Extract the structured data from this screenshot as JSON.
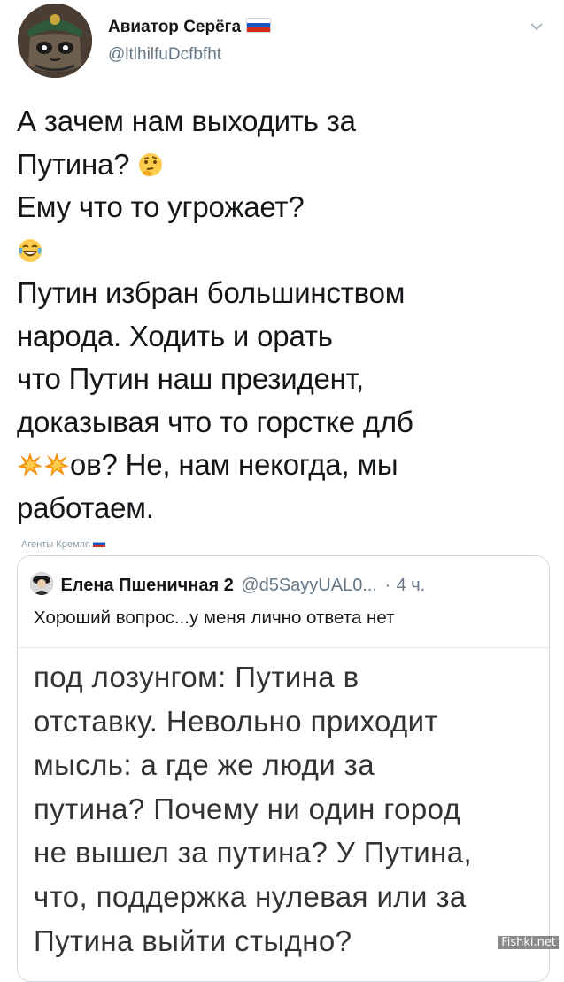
{
  "tweet": {
    "author_name": "Авиатор Серёга",
    "handle": "@ltlhilfuDcfbfht",
    "lines": [
      "А зачем нам выходить за",
      "Путина?",
      "Ему что то угрожает?",
      "",
      "Путин избран большинством",
      "народа. Ходить и орать",
      "что Путин наш президент,",
      "доказывая что то горстке длб",
      "ов? Не, нам некогда, мы",
      "работаем."
    ],
    "icons": {
      "avatar": "cat-pilot-avatar",
      "flag": "russia-flag-icon",
      "menu": "chevron-down-icon",
      "emoji_1": "thinking-face-emoji",
      "emoji_2": "face-with-tears-of-joy-emoji",
      "emoji_3": "collision-emoji"
    }
  },
  "watermark": {
    "text": "Агенты Кремля"
  },
  "quote": {
    "author_name": "Елена Пшеничная 2",
    "handle": "@d5SayyUAL0...",
    "separator": "·",
    "time": "4 ч.",
    "first_line": "Хороший вопрос...у меня лично ответа нет",
    "body_lines": [
      "под лозунгом: Путина в",
      "отставку. Невольно приходит",
      "мысль: а где же люди за",
      "путина? Почему ни один город",
      "не вышел за путина? У Путина,",
      "что, поддержка нулевая или за",
      "Путина выйти стыдно?"
    ]
  },
  "site_watermark": "Fishki.net",
  "colors": {
    "text": "#14171a",
    "secondary": "#657786",
    "border": "#cfd9de"
  }
}
